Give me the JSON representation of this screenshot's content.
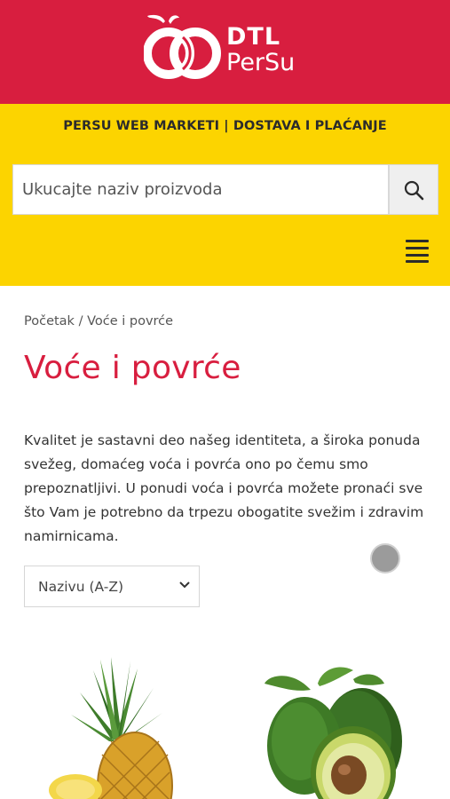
{
  "brand": {
    "logo_line1": "DTL",
    "logo_line2": "PerSu",
    "primary_color": "#d81e3f",
    "band_color": "#fcd400"
  },
  "topbar": {
    "link_text": "PERSU WEB MARKETI | DOSTAVA I PLAĆANJE"
  },
  "search": {
    "placeholder": "Ukucajte naziv proizvoda",
    "button_icon": "search-icon"
  },
  "menu": {
    "icon": "hamburger-menu-icon"
  },
  "breadcrumb": {
    "home": "Početak",
    "separator": " / ",
    "current": "Voće i povrće"
  },
  "page": {
    "title": "Voće i povrće",
    "description": "Kvalitet je sastavni deo našeg identiteta, a široka ponuda svežeg, domaćeg voća i povrća ono po čemu smo prepoznatljivi. U ponudi  voća i povrća  možete pronaći sve što Vam je potrebno da trpezu obogatite svežim i zdravim namirnicama."
  },
  "sort": {
    "selected": "Nazivu (A-Z)"
  },
  "products": [
    {
      "image": "pineapple"
    },
    {
      "image": "avocado"
    }
  ]
}
